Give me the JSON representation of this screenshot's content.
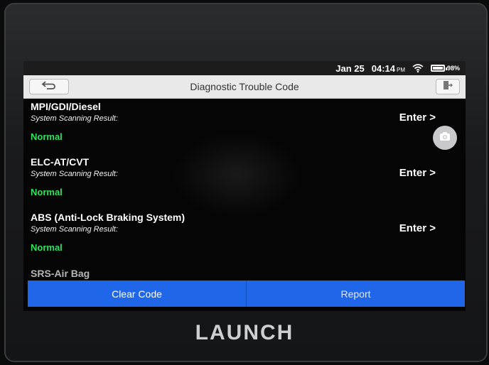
{
  "status": {
    "date": "Jan 25",
    "time": "04:14",
    "ampm": "PM",
    "battery_percent_label": "98%",
    "battery_level": 0.98
  },
  "header": {
    "title": "Diagnostic Trouble Code"
  },
  "systems": [
    {
      "name": "MPI/GDI/Diesel",
      "subtitle": "System Scanning Result:",
      "status": "Normal",
      "action": "Enter >"
    },
    {
      "name": "ELC-AT/CVT",
      "subtitle": "System Scanning Result:",
      "status": "Normal",
      "action": "Enter >"
    },
    {
      "name": "ABS (Anti-Lock Braking System)",
      "subtitle": "System Scanning Result:",
      "status": "Normal",
      "action": "Enter >"
    },
    {
      "name": "SRS-Air Bag"
    }
  ],
  "footer": {
    "clear_label": "Clear Code",
    "report_label": "Report"
  },
  "brand": "LAUNCH",
  "colors": {
    "accent": "#1f67e8",
    "normal_status": "#2fe35a"
  },
  "icons": {
    "back": "back-arrow-icon",
    "exit": "exit-icon",
    "wifi": "wifi-icon",
    "battery": "battery-icon",
    "camera": "camera-icon"
  }
}
